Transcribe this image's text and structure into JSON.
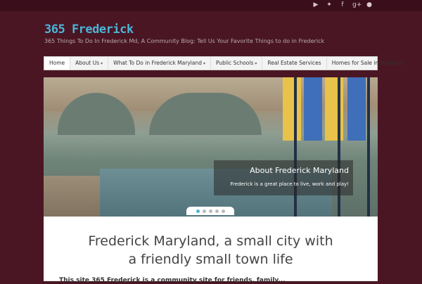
{
  "topbar": {
    "social_icons": [
      {
        "name": "youtube-icon",
        "glyph": "▶"
      },
      {
        "name": "twitter-icon",
        "glyph": "✦"
      },
      {
        "name": "facebook-icon",
        "glyph": "f"
      },
      {
        "name": "google-plus-icon",
        "glyph": "g+"
      },
      {
        "name": "user-icon",
        "glyph": "●"
      }
    ]
  },
  "header": {
    "site_title": "365 Frederick",
    "tagline": "365 Things To Do In Frederick Md, A Community Blog: Tell Us Your Favorite Things to do in Frederick"
  },
  "nav": {
    "items": [
      {
        "label": "Home",
        "active": true,
        "has_submenu": false
      },
      {
        "label": "About Us",
        "active": false,
        "has_submenu": true
      },
      {
        "label": "What To Do in Frederick Maryland",
        "active": false,
        "has_submenu": true
      },
      {
        "label": "Public Schools",
        "active": false,
        "has_submenu": true
      },
      {
        "label": "Real Estate Services",
        "active": false,
        "has_submenu": false
      },
      {
        "label": "Homes for Sale in Frederick",
        "active": false,
        "has_submenu": false
      }
    ]
  },
  "slider": {
    "caption_title": "About Frederick Maryland",
    "caption_text": "Frederick is a great place to live, work and play!",
    "slide_count": 5,
    "active_index": 0
  },
  "content": {
    "heading_line1": "Frederick Maryland, a small city with",
    "heading_line2": "a friendly small town life",
    "intro_partial": "This site 365 Frederick is a community site for friends, family..."
  },
  "colors": {
    "background": "#4a1623",
    "accent": "#4bb4d8"
  }
}
